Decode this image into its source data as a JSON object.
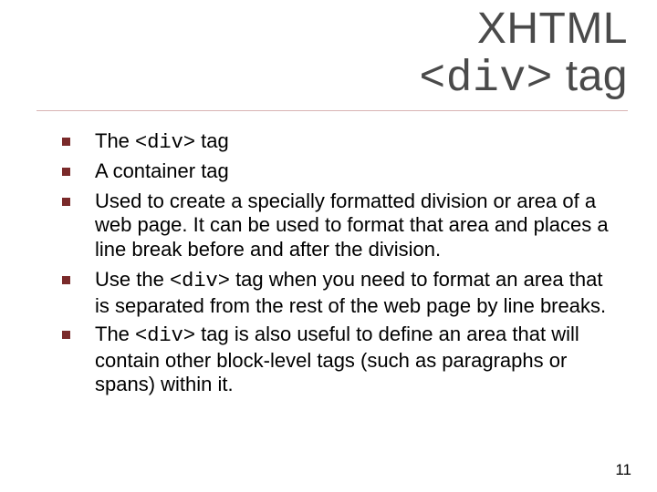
{
  "title": {
    "line1": "XHTML",
    "line2_pre": "<div>",
    "line2_post": " tag"
  },
  "bullets": [
    {
      "pre": "The ",
      "mono": "<div>",
      "post": " tag"
    },
    {
      "pre": "A container tag",
      "mono": "",
      "post": ""
    },
    {
      "pre": "Used to create a specially formatted division or area of a web page. It can be used to format that area and places a line break before and after the division.",
      "mono": "",
      "post": ""
    },
    {
      "pre": "Use the ",
      "mono": "<div>",
      "post": " tag when you need to format an area that is separated from the rest of the web page by line breaks."
    },
    {
      "pre": "The ",
      "mono": "<div>",
      "post": " tag is also useful to define an area that will contain other block-level tags (such as paragraphs or spans) within it."
    }
  ],
  "page_number": "11"
}
